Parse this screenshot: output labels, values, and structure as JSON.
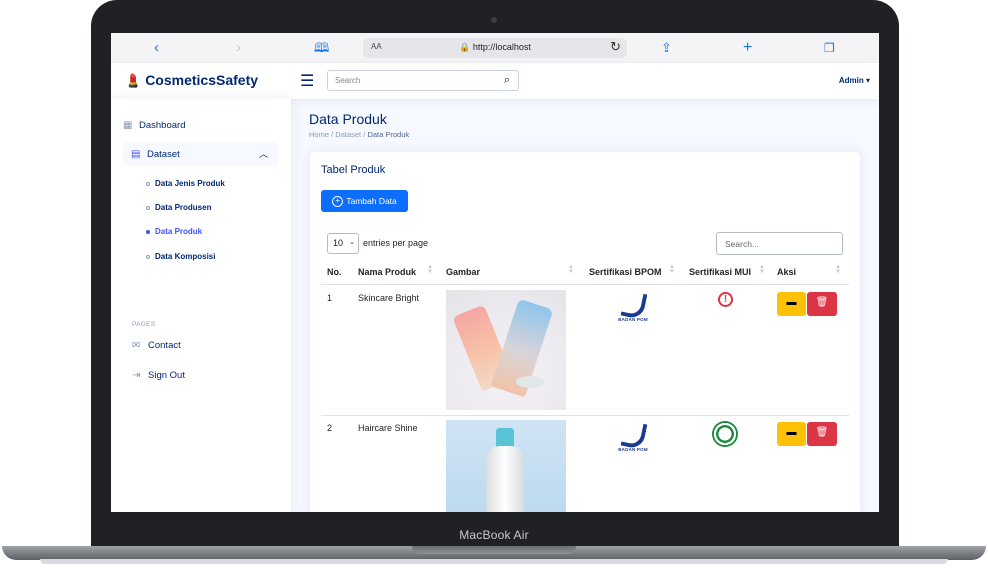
{
  "device": {
    "label": "MacBook Air"
  },
  "browser": {
    "text_size": "AA",
    "url": "http://localhost",
    "icons": [
      "back-icon",
      "forward-icon",
      "book-icon",
      "lock-icon",
      "reload-icon",
      "share-icon",
      "new-tab-icon",
      "tabs-icon"
    ]
  },
  "header": {
    "brand": "CosmeticsSafety",
    "search_placeholder": "Search",
    "user": "Admin"
  },
  "sidebar": {
    "items": [
      {
        "label": "Dashboard",
        "icon": "grid-icon"
      },
      {
        "label": "Dataset",
        "icon": "table-icon",
        "expanded": true
      }
    ],
    "subitems": [
      {
        "label": "Data Jenis Produk",
        "active": false
      },
      {
        "label": "Data Produsen",
        "active": false
      },
      {
        "label": "Data Produk",
        "active": true
      },
      {
        "label": "Data Komposisi",
        "active": false
      }
    ],
    "section": "PAGES",
    "pages": [
      {
        "label": "Contact",
        "icon": "envelope-icon"
      },
      {
        "label": "Sign Out",
        "icon": "sign-out-icon"
      }
    ]
  },
  "main": {
    "title": "Data Produk",
    "breadcrumb": {
      "home": "Home",
      "sep": "/",
      "parent": "Dataset",
      "current": "Data Produk"
    },
    "card_title": "Tabel Produk",
    "add_button": "Tambah Data",
    "page_size": "10",
    "entries_label": "entries per page",
    "table_search_placeholder": "Search...",
    "columns": [
      "No.",
      "Nama Produk",
      "Gambar",
      "Sertifikasi BPOM",
      "Sertifikasi MUI",
      "Aksi"
    ],
    "rows": [
      {
        "no": "1",
        "name": "Skincare Bright",
        "bpom_logo_text": "BADAN POM",
        "mui": "warning-icon"
      },
      {
        "no": "2",
        "name": "Haircare Shine",
        "bpom_logo_text": "BADAN POM",
        "mui": "halal-logo-icon"
      }
    ]
  },
  "colors": {
    "primary": "#4154f1",
    "navy": "#012970",
    "btn_primary": "#0d6efd",
    "warning": "#ffc107",
    "danger": "#dc3545"
  }
}
